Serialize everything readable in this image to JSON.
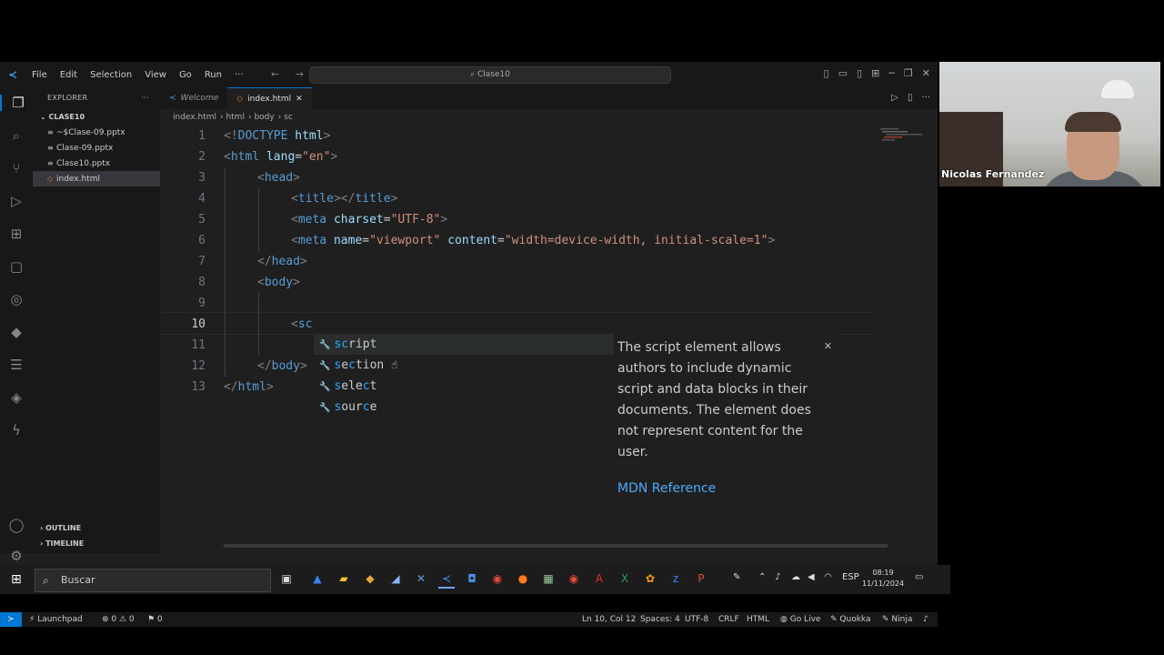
{
  "menu": [
    "File",
    "Edit",
    "Selection",
    "View",
    "Go",
    "Run",
    "···"
  ],
  "command_center": "Clase10",
  "explorer": {
    "title": "EXPLORER",
    "folder": "CLASE10",
    "files": [
      {
        "name": "~$Clase-09.pptx",
        "icon": "file-icon"
      },
      {
        "name": "Clase-09.pptx",
        "icon": "file-icon"
      },
      {
        "name": "Clase10.pptx",
        "icon": "file-icon"
      },
      {
        "name": "index.html",
        "icon": "html-file-icon",
        "selected": true
      }
    ],
    "outline": "OUTLINE",
    "timeline": "TIMELINE"
  },
  "tabs": [
    {
      "label": "Welcome",
      "active": false
    },
    {
      "label": "index.html",
      "active": true
    }
  ],
  "breadcrumb": [
    "index.html",
    "html",
    "body",
    "sc"
  ],
  "code_lines": [
    {
      "n": "1",
      "text": "<!DOCTYPE html>"
    },
    {
      "n": "2",
      "text": "<html lang=\"en\">"
    },
    {
      "n": "3",
      "text": "<head>"
    },
    {
      "n": "4",
      "text": "<title></title>"
    },
    {
      "n": "5",
      "text": "<meta charset=\"UTF-8\">"
    },
    {
      "n": "6",
      "text": "<meta name=\"viewport\" content=\"width=device-width, initial-scale=1\">"
    },
    {
      "n": "7",
      "text": "</head>"
    },
    {
      "n": "8",
      "text": "<body>"
    },
    {
      "n": "9",
      "text": ""
    },
    {
      "n": "10",
      "text": "<sc"
    },
    {
      "n": "11",
      "text": ""
    },
    {
      "n": "12",
      "text": "</body>"
    },
    {
      "n": "13",
      "text": "</html>"
    }
  ],
  "suggestions": [
    "script",
    "section",
    "select",
    "source"
  ],
  "doc_popup": {
    "text": "The script element allows authors to include dynamic script and data blocks in their documents. The element does not represent content for the user.",
    "link": "MDN Reference"
  },
  "status": {
    "launchpad": "Launchpad",
    "problems": "⊗ 0 ⚠ 0",
    "ports": "⚑ 0",
    "position": "Ln 10, Col 12",
    "spaces": "Spaces: 4",
    "encoding": "UTF-8",
    "eol": "CRLF",
    "language": "HTML",
    "golive": "Go Live",
    "quokka": "Quokka",
    "ninja": "Ninja"
  },
  "webcam_name": "Nicolas Fernandez",
  "taskbar": {
    "search_placeholder": "Buscar",
    "lang": "ESP",
    "time": "08:19",
    "date": "11/11/2024"
  },
  "colors": {
    "accent": "#0078d4",
    "tag": "#569cd6",
    "attr": "#9cdcfe",
    "string": "#ce9178",
    "match": "#2aaaff"
  }
}
